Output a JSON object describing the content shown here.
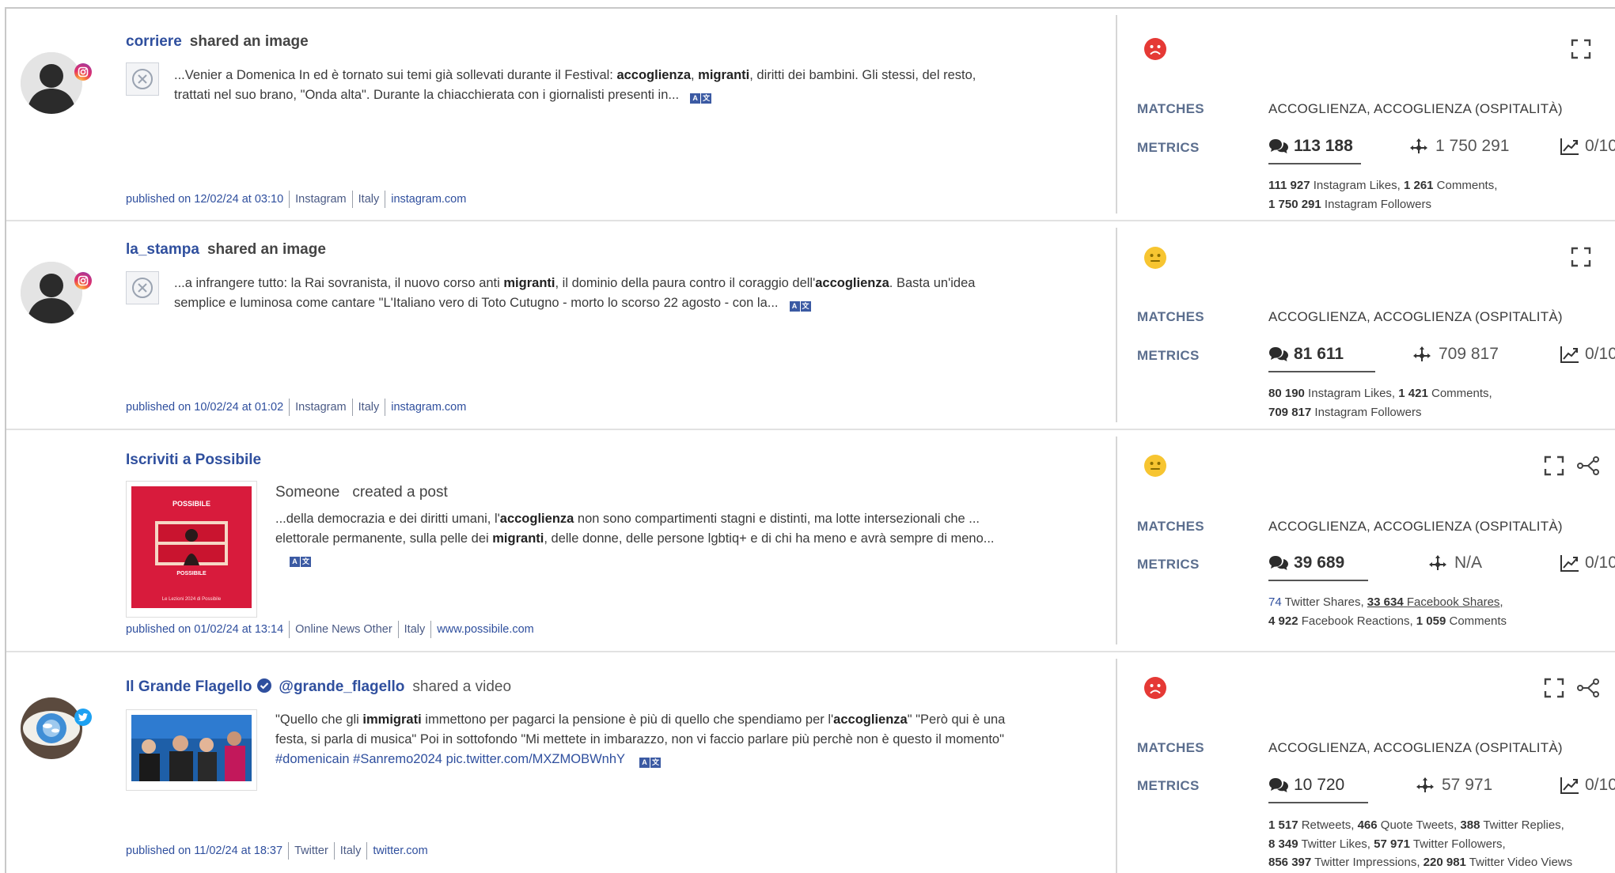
{
  "labels": {
    "matches": "MATCHES",
    "metrics": "METRICS"
  },
  "colors": {
    "accent": "#2f4f9e",
    "negative": "#e53935",
    "neutral": "#f7c531",
    "twitter": "#1da1f2"
  },
  "translate": {
    "a": "A",
    "b": "文"
  },
  "posts": [
    {
      "author": "corriere",
      "action": "shared an image",
      "network_icon": "instagram-icon",
      "snippet_parts": [
        "...Venier a Domenica In ed è tornato sui temi già sollevati durante il Festival: ",
        "accoglienza",
        ", ",
        "migranti",
        ", diritti dei bambini. Gli stessi, del resto,",
        "trattati nel suo brano, \"Onda alta\". Durante la chiacchierata con i giornalisti presenti in..."
      ],
      "meta": [
        "published on 12/02/24 at 03:10",
        "Instagram",
        "Italy",
        "instagram.com"
      ],
      "sentiment": "negative",
      "matches": "ACCOGLIENZA, ACCOGLIENZA (OSPITALITÀ)",
      "metric_main": "113 188",
      "metric_reach": "1 750 291",
      "metric_trend": "0/10",
      "details": [
        [
          "111 927",
          " Instagram Likes, ",
          "1 261",
          " Comments,"
        ],
        [
          "1 750 291",
          " Instagram Followers"
        ]
      ]
    },
    {
      "author": "la_stampa",
      "action": "shared an image",
      "network_icon": "instagram-icon",
      "snippet_parts": [
        "...a infrangere tutto: la Rai sovranista, il nuovo corso anti ",
        "migranti",
        ", il dominio della paura contro il coraggio dell'",
        "accoglienza",
        ". Basta un'idea",
        "semplice e luminosa come cantare \"L'Italiano vero di Toto Cutugno - morto lo scorso 22 agosto - con la..."
      ],
      "meta": [
        "published on 10/02/24 at 01:02",
        "Instagram",
        "Italy",
        "instagram.com"
      ],
      "sentiment": "neutral",
      "matches": "ACCOGLIENZA, ACCOGLIENZA (OSPITALITÀ)",
      "metric_main": "81 611",
      "metric_reach": "709 817",
      "metric_trend": "0/10",
      "details": [
        [
          "80 190",
          " Instagram Likes, ",
          "1 421",
          " Comments,"
        ],
        [
          "709 817",
          " Instagram Followers"
        ]
      ]
    },
    {
      "author": "Iscriviti a Possibile",
      "someone": "Someone",
      "action": "created a post",
      "thumb_title": "POSSIBILE",
      "thumb_sub": "POSSIBILE",
      "thumb_caption": "Le Lezioni 2024 di Possibile",
      "snippet_parts": [
        "...della democrazia e dei diritti umani, l'",
        "accoglienza",
        " non sono compartimenti stagni e distinti, ma lotte intersezionali che ...",
        "elettorale permanente, sulla pelle dei ",
        "migranti",
        ", delle donne, delle persone lgbtiq+ e di chi ha meno e avrà sempre di meno..."
      ],
      "meta": [
        "published on 01/02/24 at 13:14",
        "Online News Other",
        "Italy",
        "www.possibile.com"
      ],
      "sentiment": "neutral",
      "matches": "ACCOGLIENZA, ACCOGLIENZA (OSPITALITÀ)",
      "metric_main": "39 689",
      "metric_reach": "N/A",
      "metric_trend": "0/10",
      "details": [
        [
          "74",
          " Twitter Shares, ",
          "33 634",
          " Facebook Shares,"
        ],
        [
          "4 922",
          " Facebook Reactions, ",
          "1 059",
          " Comments"
        ]
      ]
    },
    {
      "author": "Il Grande Flagello",
      "handle": "@grande_flagello",
      "action": "shared a video",
      "network_icon": "twitter-icon",
      "snippet_parts": [
        "\"Quello che gli ",
        "immigrati",
        " immettono per pagarci la pensione è più di quello che spendiamo per l'",
        "accoglienza",
        "\" \"Però qui è una",
        "festa, si parla di musica\" Poi in sottofondo \"Mi mettete in imbarazzo, non vi faccio parlare più perchè non è questo il momento\"",
        "#domenicain #Sanremo2024 pic.twitter.com/MXZMOBWnhY"
      ],
      "meta": [
        "published on 11/02/24 at 18:37",
        "Twitter",
        "Italy",
        "twitter.com"
      ],
      "sentiment": "negative",
      "matches": "ACCOGLIENZA, ACCOGLIENZA (OSPITALITÀ)",
      "metric_main": "10 720",
      "metric_reach": "57 971",
      "metric_trend": "0/10",
      "details": [
        [
          "1 517",
          " Retweets, ",
          "466",
          " Quote Tweets, ",
          "388",
          " Twitter Replies,"
        ],
        [
          "8 349",
          " Twitter Likes, ",
          "57 971",
          " Twitter Followers,"
        ],
        [
          "856 397",
          " Twitter Impressions, ",
          "220 981",
          " Twitter Video Views"
        ]
      ]
    }
  ]
}
